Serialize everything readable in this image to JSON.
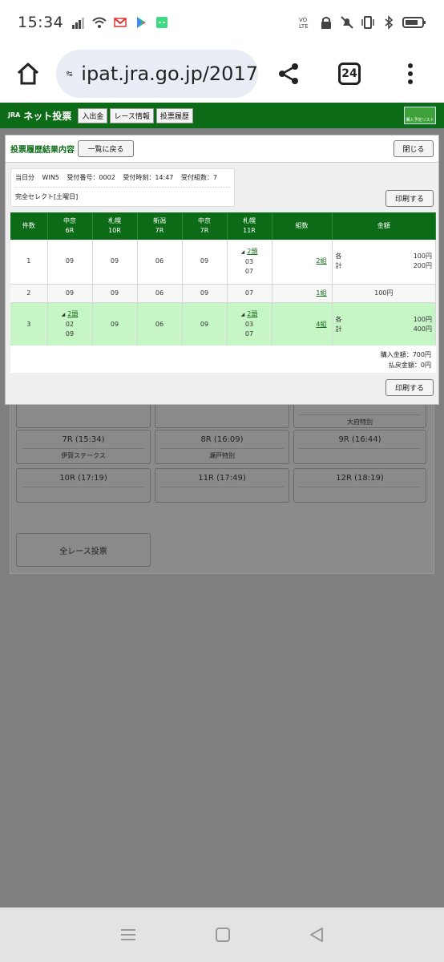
{
  "status_bar": {
    "time": "15:34",
    "icons_left": [
      "signal-icon",
      "wifi-icon",
      "gmail-icon",
      "play-store-icon",
      "android-icon"
    ],
    "icons_right": [
      "volte-icon",
      "nfc-icon",
      "mute-icon",
      "vibrate-icon",
      "bluetooth-icon",
      "battery-icon"
    ]
  },
  "browser": {
    "url": "ipat.jra.go.jp/2017",
    "tab_count": "24"
  },
  "site_nav": {
    "logo": "ネット投票",
    "logo_sub": "JRA",
    "items": [
      "入出金",
      "レース情報",
      "投票履歴"
    ],
    "list_button": "購入予定リスト"
  },
  "modal": {
    "title": "投票履歴結果内容",
    "back_button": "一覧に戻る",
    "close_button": "閉じる",
    "print_button": "印刷する",
    "info": {
      "day": "当日分",
      "type": "WIN5",
      "receipt_no": "受付番号：0002",
      "receipt_time": "受付時刻：14:47",
      "receipt_count": "受付組数：7",
      "method": "完全セレクト[土曜日]"
    },
    "table": {
      "headers": [
        {
          "l1": "件数",
          "l2": ""
        },
        {
          "l1": "中京",
          "l2": "6R"
        },
        {
          "l1": "札幌",
          "l2": "10R"
        },
        {
          "l1": "新潟",
          "l2": "7R"
        },
        {
          "l1": "中京",
          "l2": "7R"
        },
        {
          "l1": "札幌",
          "l2": "11R"
        },
        {
          "l1": "組数",
          "l2": ""
        },
        {
          "l1": "金額",
          "l2": ""
        }
      ],
      "rows": [
        {
          "no": "1",
          "c1": {
            "link": "",
            "vals": [
              "09"
            ]
          },
          "c2": "09",
          "c3": "06",
          "c4": "09",
          "c5": {
            "link": "2頭",
            "vals": [
              "03",
              "07"
            ]
          },
          "kumi": "2組",
          "amount": {
            "label1": "各",
            "val1": "100円",
            "label2": "計",
            "val2": "200円"
          }
        },
        {
          "no": "2",
          "c1": {
            "link": "",
            "vals": [
              "09"
            ]
          },
          "c2": "09",
          "c3": "06",
          "c4": "09",
          "c5": {
            "link": "",
            "vals": [
              "07"
            ]
          },
          "kumi": "1組",
          "amount": {
            "label1": "",
            "val1": "100円",
            "label2": "",
            "val2": ""
          }
        },
        {
          "no": "3",
          "c1": {
            "link": "2頭",
            "vals": [
              "02",
              "09"
            ]
          },
          "c2": "09",
          "c3": "06",
          "c4": "09",
          "c5": {
            "link": "2頭",
            "vals": [
              "03",
              "07"
            ]
          },
          "kumi": "4組",
          "amount": {
            "label1": "各",
            "val1": "100円",
            "label2": "計",
            "val2": "400円"
          }
        }
      ]
    },
    "totals": {
      "purchase": "購入金額：700円",
      "refund": "払戻金額：0円"
    }
  },
  "background": {
    "partial_label": "大府特別",
    "races": [
      {
        "label": "7R (15:34)",
        "sub": "伊賀ステークス"
      },
      {
        "label": "8R (16:09)",
        "sub": "瀬戸特別"
      },
      {
        "label": "9R (16:44)",
        "sub": ""
      },
      {
        "label": "10R (17:19)",
        "sub": ""
      },
      {
        "label": "11R (17:49)",
        "sub": ""
      },
      {
        "label": "12R (18:19)",
        "sub": ""
      }
    ],
    "all_races_button": "全レース投票"
  }
}
